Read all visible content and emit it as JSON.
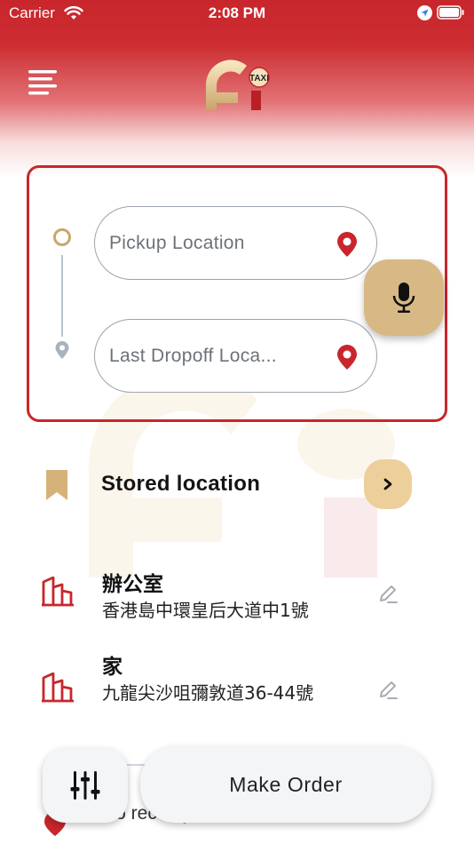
{
  "status_bar": {
    "carrier": "Carrier",
    "time": "2:08 PM",
    "icons": [
      "wifi-icon",
      "location-arrow-icon",
      "battery-icon"
    ]
  },
  "header": {
    "menu_icon": "menu-lines-icon",
    "logo_badge": "TAXI"
  },
  "route": {
    "pickup_placeholder": "Pickup Location",
    "dropoff_placeholder": "Last Dropoff Loca...",
    "pin_icon": "map-pin-icon",
    "mic_icon": "microphone-icon"
  },
  "stored": {
    "title": "Stored location",
    "icon": "bookmark-icon",
    "arrow_icon": "chevron-right-icon"
  },
  "places": [
    {
      "name": "辦公室",
      "address": "香港島中環皇后大道中1號",
      "icon": "building-icon"
    },
    {
      "name": "家",
      "address": "九龍尖沙咀彌敦道36-44號",
      "icon": "building-icon"
    }
  ],
  "partial_row": {
    "text": "No recor..y"
  },
  "footer": {
    "filter_icon": "sliders-icon",
    "make_order_label": "Make Order"
  },
  "colors": {
    "brand_red": "#c8262c",
    "gold": "#d8b985",
    "light_gold": "#edcf9c"
  }
}
